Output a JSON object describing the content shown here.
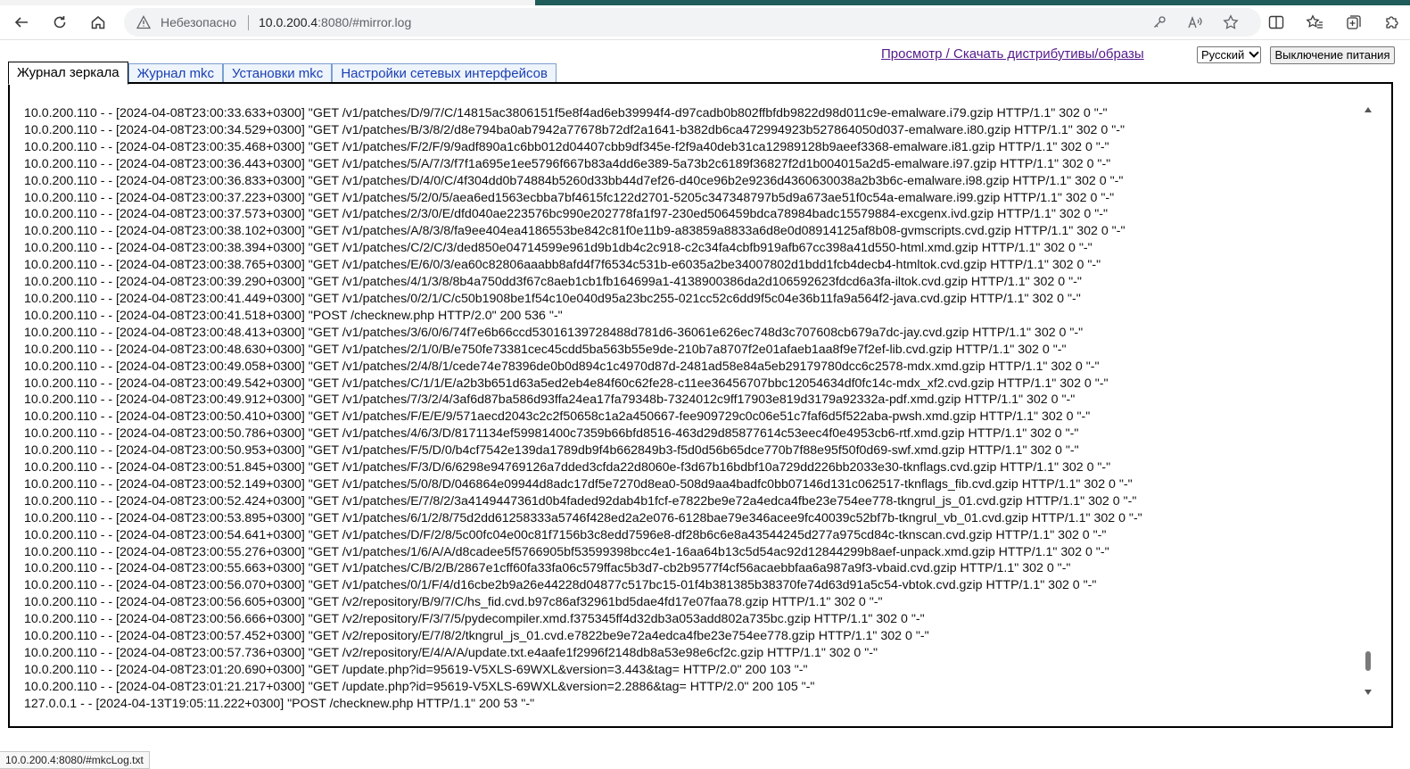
{
  "browser": {
    "security_label": "Небезопасно",
    "url_host": "10.0.200.4",
    "url_rest": ":8080/#mirror.log"
  },
  "header": {
    "link": "Просмотр / Скачать дистрибутивы/образы",
    "language": "Русский",
    "power_button": "Выключение питания"
  },
  "tabs": [
    {
      "label": "Журнал зеркала"
    },
    {
      "label": "Журнал mkc"
    },
    {
      "label": "Установки mkc"
    },
    {
      "label": "Настройки сетевых интерфейсов"
    }
  ],
  "log": {
    "lines": [
      "10.0.200.110 - - [2024-04-08T23:00:33.633+0300] \"GET /v1/patches/D/9/7/C/14815ac3806151f5e8f4ad6eb39994f4-d97cadb0b802ffbfdb9822d98d011c9e-emalware.i79.gzip HTTP/1.1\" 302 0 \"-\"",
      "10.0.200.110 - - [2024-04-08T23:00:34.529+0300] \"GET /v1/patches/B/3/8/2/d8e794ba0ab7942a77678b72df2a1641-b382db6ca472994923b527864050d037-emalware.i80.gzip HTTP/1.1\" 302 0 \"-\"",
      "10.0.200.110 - - [2024-04-08T23:00:35.468+0300] \"GET /v1/patches/F/2/F/9/9adf890a1c6bb012d04407cbb9df345e-f2f9a40deb31ca12989128b9aeef3368-emalware.i81.gzip HTTP/1.1\" 302 0 \"-\"",
      "10.0.200.110 - - [2024-04-08T23:00:36.443+0300] \"GET /v1/patches/5/A/7/3/f7f1a695e1ee5796f667b83a4dd6e389-5a73b2c6189f36827f2d1b004015a2d5-emalware.i97.gzip HTTP/1.1\" 302 0 \"-\"",
      "10.0.200.110 - - [2024-04-08T23:00:36.833+0300] \"GET /v1/patches/D/4/0/C/4f304dd0b74884b5260d33bb44d7ef26-d40ce96b2e9236d4360630038a2b3b6c-emalware.i98.gzip HTTP/1.1\" 302 0 \"-\"",
      "10.0.200.110 - - [2024-04-08T23:00:37.223+0300] \"GET /v1/patches/5/2/0/5/aea6ed1563ecbba7bf4615fc122d2701-5205c347348797b5d9a673ae51f0c54a-emalware.i99.gzip HTTP/1.1\" 302 0 \"-\"",
      "10.0.200.110 - - [2024-04-08T23:00:37.573+0300] \"GET /v1/patches/2/3/0/E/dfd040ae223576bc990e202778fa1f97-230ed506459bdca78984badc15579884-excgenx.ivd.gzip HTTP/1.1\" 302 0 \"-\"",
      "10.0.200.110 - - [2024-04-08T23:00:38.102+0300] \"GET /v1/patches/A/8/3/8/fa9ee404ea4186553be842c81f0e11b9-a83859a8833a6d8e0d08914125af8b08-gvmscripts.cvd.gzip HTTP/1.1\" 302 0 \"-\"",
      "10.0.200.110 - - [2024-04-08T23:00:38.394+0300] \"GET /v1/patches/C/2/C/3/ded850e04714599e961d9b1db4c2c918-c2c34fa4cbfb919afb67cc398a41d550-html.xmd.gzip HTTP/1.1\" 302 0 \"-\"",
      "10.0.200.110 - - [2024-04-08T23:00:38.765+0300] \"GET /v1/patches/E/6/0/3/ea60c82806aaabb8afd4f7f6534c531b-e6035a2be34007802d1bdd1fcb4decb4-htmltok.cvd.gzip HTTP/1.1\" 302 0 \"-\"",
      "10.0.200.110 - - [2024-04-08T23:00:39.290+0300] \"GET /v1/patches/4/1/3/8/8b4a750dd3f67c8aeb1cb1fb164699a1-4138900386da2d106592623fdcd6a3fa-iltok.cvd.gzip HTTP/1.1\" 302 0 \"-\"",
      "10.0.200.110 - - [2024-04-08T23:00:41.449+0300] \"GET /v1/patches/0/2/1/C/c50b1908be1f54c10e040d95a23bc255-021cc52c6dd9f5c04e36b11fa9a564f2-java.cvd.gzip HTTP/1.1\" 302 0 \"-\"",
      "10.0.200.110 - - [2024-04-08T23:00:41.518+0300] \"POST /checknew.php HTTP/2.0\" 200 536 \"-\"",
      "10.0.200.110 - - [2024-04-08T23:00:48.413+0300] \"GET /v1/patches/3/6/0/6/74f7e6b66ccd53016139728488d781d6-36061e626ec748d3c707608cb679a7dc-jay.cvd.gzip HTTP/1.1\" 302 0 \"-\"",
      "10.0.200.110 - - [2024-04-08T23:00:48.630+0300] \"GET /v1/patches/2/1/0/B/e750fe73381cec45cdd5ba563b55e9de-210b7a8707f2e01afaeb1aa8f9e7f2ef-lib.cvd.gzip HTTP/1.1\" 302 0 \"-\"",
      "10.0.200.110 - - [2024-04-08T23:00:49.058+0300] \"GET /v1/patches/2/4/8/1/cede74e78396de0b0d894c1c4970d87d-2481ad58e84a5eb29179780dcc6c2578-mdx.xmd.gzip HTTP/1.1\" 302 0 \"-\"",
      "10.0.200.110 - - [2024-04-08T23:00:49.542+0300] \"GET /v1/patches/C/1/1/E/a2b3b651d63a5ed2eb4e84f60c62fe28-c11ee36456707bbc12054634df0fc14c-mdx_xf2.cvd.gzip HTTP/1.1\" 302 0 \"-\"",
      "10.0.200.110 - - [2024-04-08T23:00:49.912+0300] \"GET /v1/patches/7/3/2/4/3af6d87ba586d93ffa24ea17fa79348b-7324012c9ff17903e819d3179a92332a-pdf.xmd.gzip HTTP/1.1\" 302 0 \"-\"",
      "10.0.200.110 - - [2024-04-08T23:00:50.410+0300] \"GET /v1/patches/F/E/E/9/571aecd2043c2c2f50658c1a2a450667-fee909729c0c06e51c7faf6d5f522aba-pwsh.xmd.gzip HTTP/1.1\" 302 0 \"-\"",
      "10.0.200.110 - - [2024-04-08T23:00:50.786+0300] \"GET /v1/patches/4/6/3/D/8171134ef59981400c7359b66bfd8516-463d29d85877614c53eec4f0e4953cb6-rtf.xmd.gzip HTTP/1.1\" 302 0 \"-\"",
      "10.0.200.110 - - [2024-04-08T23:00:50.953+0300] \"GET /v1/patches/F/5/D/0/b4cf7542e139da1789db9f4b662849b3-f5d0d56b65dce770b7f88e95f50f0d69-swf.xmd.gzip HTTP/1.1\" 302 0 \"-\"",
      "10.0.200.110 - - [2024-04-08T23:00:51.845+0300] \"GET /v1/patches/F/3/D/6/6298e94769126a7dded3cfda22d8060e-f3d67b16bdbf10a729dd226bb2033e30-tknflags.cvd.gzip HTTP/1.1\" 302 0 \"-\"",
      "10.0.200.110 - - [2024-04-08T23:00:52.149+0300] \"GET /v1/patches/5/0/8/D/046864e09944d8adc17df5e7270d8ea0-508d9aa4badfc0bb07146d131c062517-tknflags_fib.cvd.gzip HTTP/1.1\" 302 0 \"-\"",
      "10.0.200.110 - - [2024-04-08T23:00:52.424+0300] \"GET /v1/patches/E/7/8/2/3a4149447361d0b4faded92dab4b1fcf-e7822be9e72a4edca4fbe23e754ee778-tkngrul_js_01.cvd.gzip HTTP/1.1\" 302 0 \"-\"",
      "10.0.200.110 - - [2024-04-08T23:00:53.895+0300] \"GET /v1/patches/6/1/2/8/75d2dd61258333a5746f428ed2a2e076-6128bae79e346acee9fc40039c52bf7b-tkngrul_vb_01.cvd.gzip HTTP/1.1\" 302 0 \"-\"",
      "10.0.200.110 - - [2024-04-08T23:00:54.641+0300] \"GET /v1/patches/D/F/2/8/5c00fc04e00c81f7156b3c8edd7596e8-df28b6c6e8a43544245d277a975cd84c-tknscan.cvd.gzip HTTP/1.1\" 302 0 \"-\"",
      "10.0.200.110 - - [2024-04-08T23:00:55.276+0300] \"GET /v1/patches/1/6/A/A/d8cadee5f5766905bf53599398bcc4e1-16aa64b13c5d54ac92d12844299b8aef-unpack.xmd.gzip HTTP/1.1\" 302 0 \"-\"",
      "10.0.200.110 - - [2024-04-08T23:00:55.663+0300] \"GET /v1/patches/C/B/2/B/2867e1cff60fa33fa06c579ffac5b3d7-cb2b9577f4cf56acaebbfaa6a987a9f3-vbaid.cvd.gzip HTTP/1.1\" 302 0 \"-\"",
      "10.0.200.110 - - [2024-04-08T23:00:56.070+0300] \"GET /v1/patches/0/1/F/4/d16cbe2b9a26e44228d04877c517bc15-01f4b381385b38370fe74d63d91a5c54-vbtok.cvd.gzip HTTP/1.1\" 302 0 \"-\"",
      "10.0.200.110 - - [2024-04-08T23:00:56.605+0300] \"GET /v2/repository/B/9/7/C/hs_fid.cvd.b97c86af32961bd5dae4fd17e07faa78.gzip HTTP/1.1\" 302 0 \"-\"",
      "10.0.200.110 - - [2024-04-08T23:00:56.666+0300] \"GET /v2/repository/F/3/7/5/pydecompiler.xmd.f375345ff4d32db3a053add802a735bc.gzip HTTP/1.1\" 302 0 \"-\"",
      "10.0.200.110 - - [2024-04-08T23:00:57.452+0300] \"GET /v2/repository/E/7/8/2/tkngrul_js_01.cvd.e7822be9e72a4edca4fbe23e754ee778.gzip HTTP/1.1\" 302 0 \"-\"",
      "10.0.200.110 - - [2024-04-08T23:00:57.736+0300] \"GET /v2/repository/E/4/A/A/update.txt.e4aafe1f2996f2148db8a53e98e6cf2c.gzip HTTP/1.1\" 302 0 \"-\"",
      "10.0.200.110 - - [2024-04-08T23:01:20.690+0300] \"GET /update.php?id=95619-V5XLS-69WXL&version=3.443&tag= HTTP/2.0\" 200 103 \"-\"",
      "10.0.200.110 - - [2024-04-08T23:01:21.217+0300] \"GET /update.php?id=95619-V5XLS-69WXL&version=2.2886&tag= HTTP/2.0\" 200 105 \"-\"",
      "127.0.0.1 - - [2024-04-13T19:05:11.222+0300] \"POST /checknew.php HTTP/1.1\" 200 53 \"-\""
    ]
  },
  "statusbar": {
    "text": "10.0.200.4:8080/#mkcLog.txt"
  },
  "colors": {
    "link": "#551a8b",
    "tab_text": "#1a3fb3",
    "tab_border": "#7a9fd0"
  }
}
